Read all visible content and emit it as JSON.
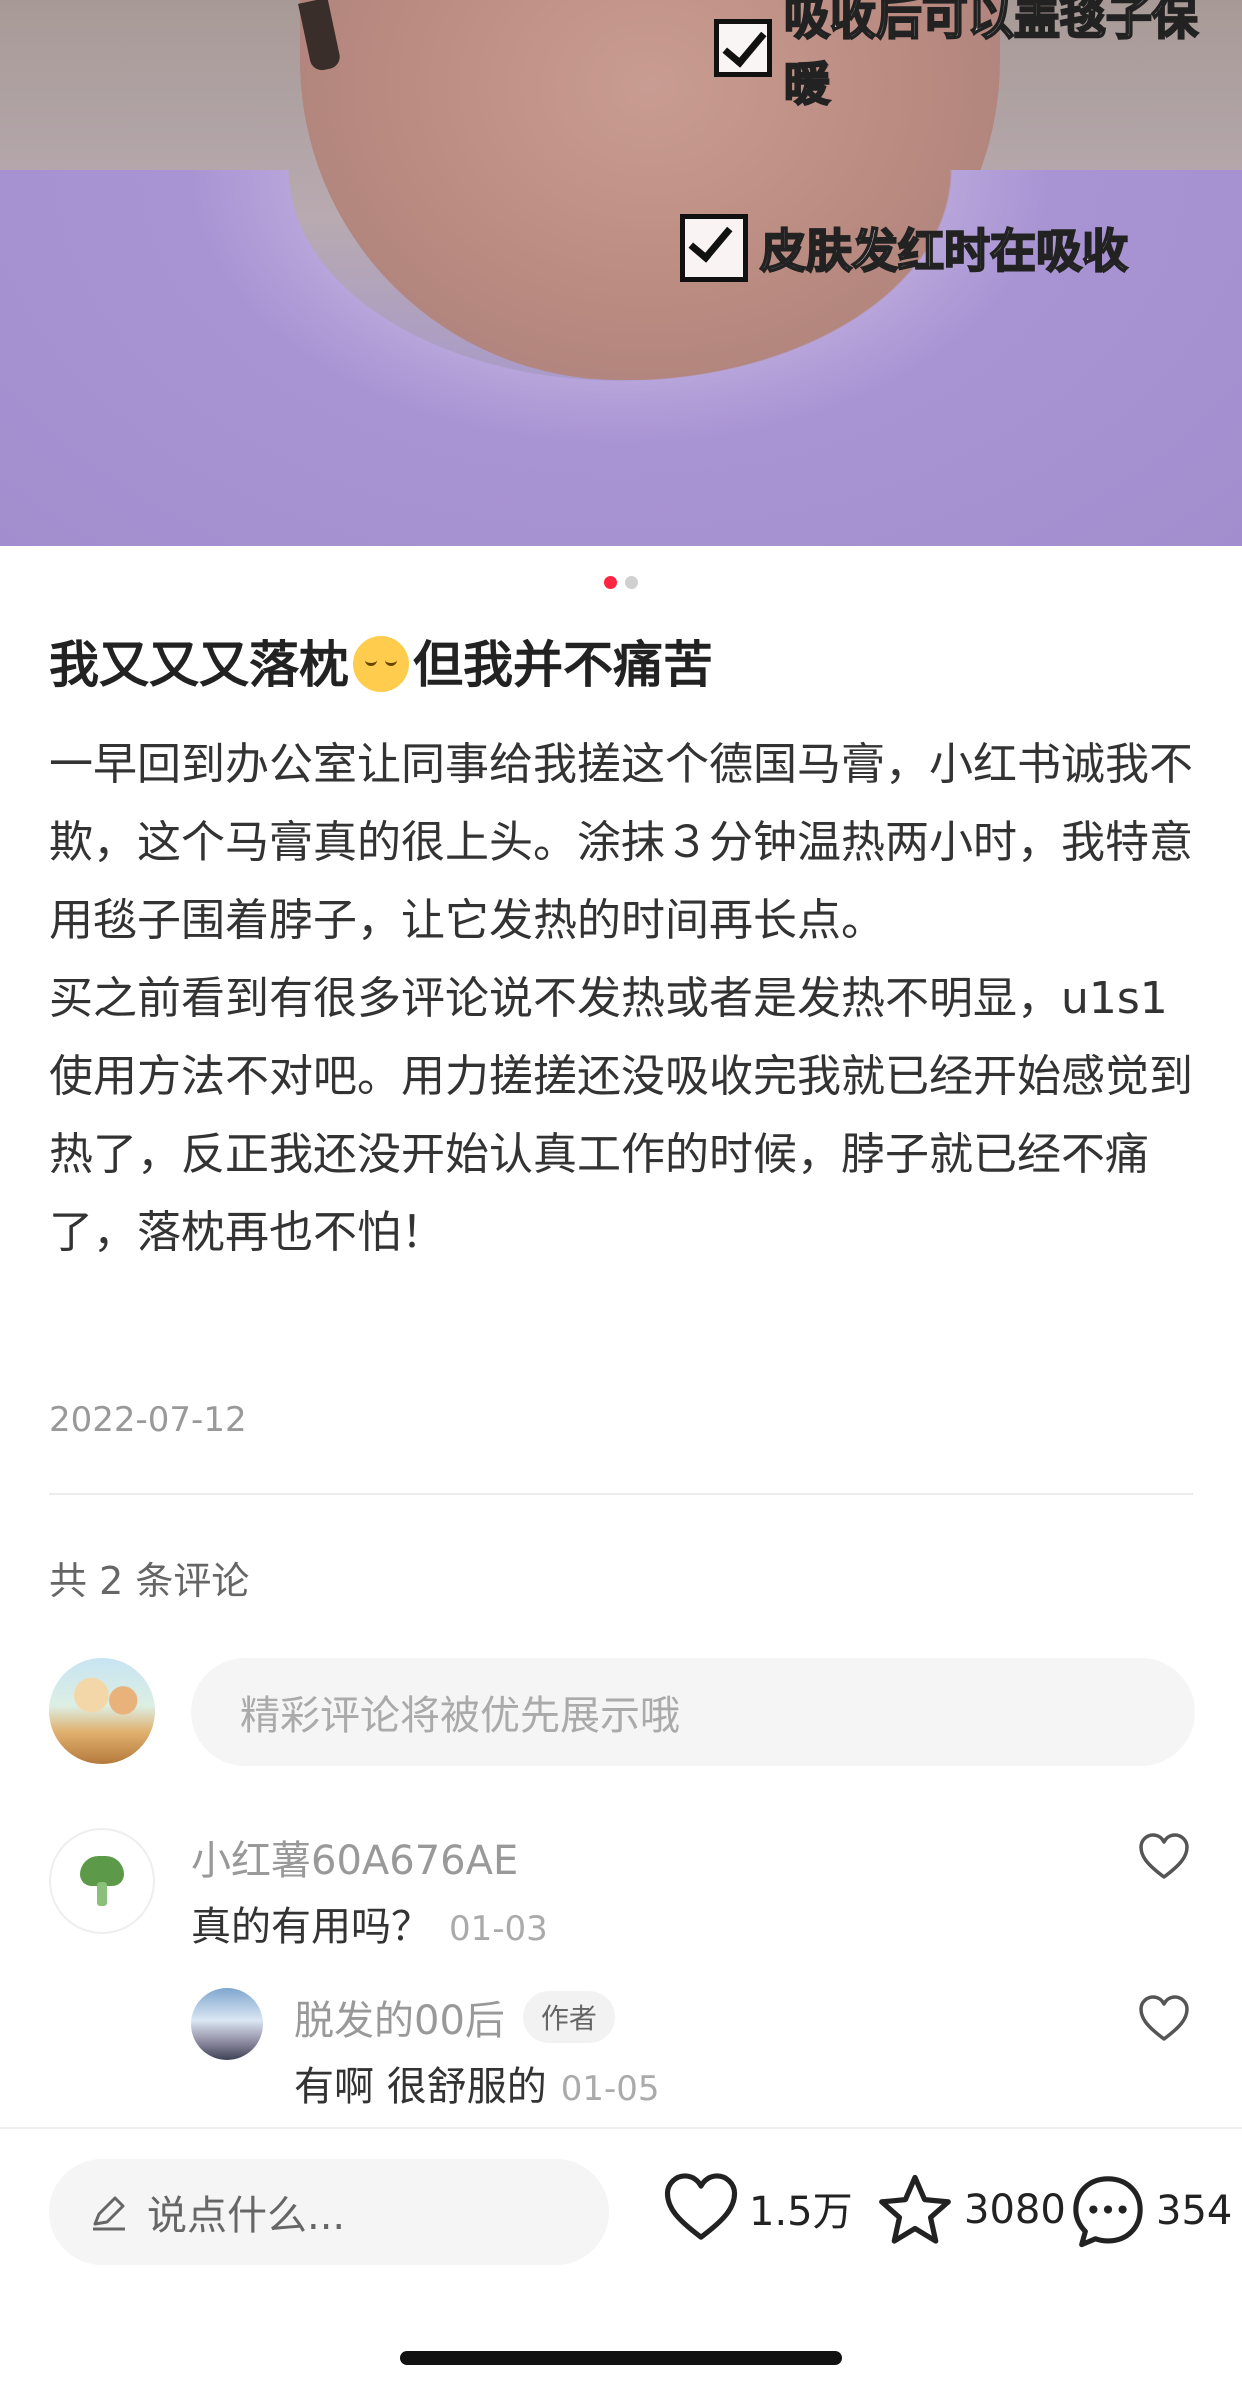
{
  "hero": {
    "overlay_top": "吸收后可以盖毯子保暖",
    "overlay_bottom": "皮肤发红时在吸收",
    "page_index": 1,
    "page_count": 2
  },
  "post": {
    "title_before": "我又又又落枕",
    "title_emoji": "relieved-face-emoji",
    "title_after": "但我并不痛苦",
    "paragraph_1": "一早回到办公室让同事给我搓这个德国马膏，小红书诚我不欺，这个马膏真的很上头。涂抹３分钟温热两小时，我特意用毯子围着脖子，让它发热的时间再长点。",
    "paragraph_2": "买之前看到有很多评论说不发热或者是发热不明显，u1s1使用方法不对吧。用力搓搓还没吸收完我就已经开始感觉到热了，反正我还没开始认真工作的时候，脖子就已经不痛了，落枕再也不怕！",
    "date": "2022-07-12"
  },
  "comments": {
    "count_label": "共 2 条评论",
    "input_placeholder": "精彩评论将被优先展示哦",
    "items": [
      {
        "name": "小红薯60A676AE",
        "text": "真的有用吗？",
        "time": "01-03"
      },
      {
        "name": "脱发的00后",
        "badge": "作者",
        "text": "有啊 很舒服的",
        "time": "01-05"
      }
    ]
  },
  "bottom": {
    "say_placeholder": "说点什么...",
    "likes": "1.5万",
    "collects": "3080",
    "comments": "354"
  },
  "colors": {
    "accent": "#ff2442",
    "muted": "#999999"
  }
}
